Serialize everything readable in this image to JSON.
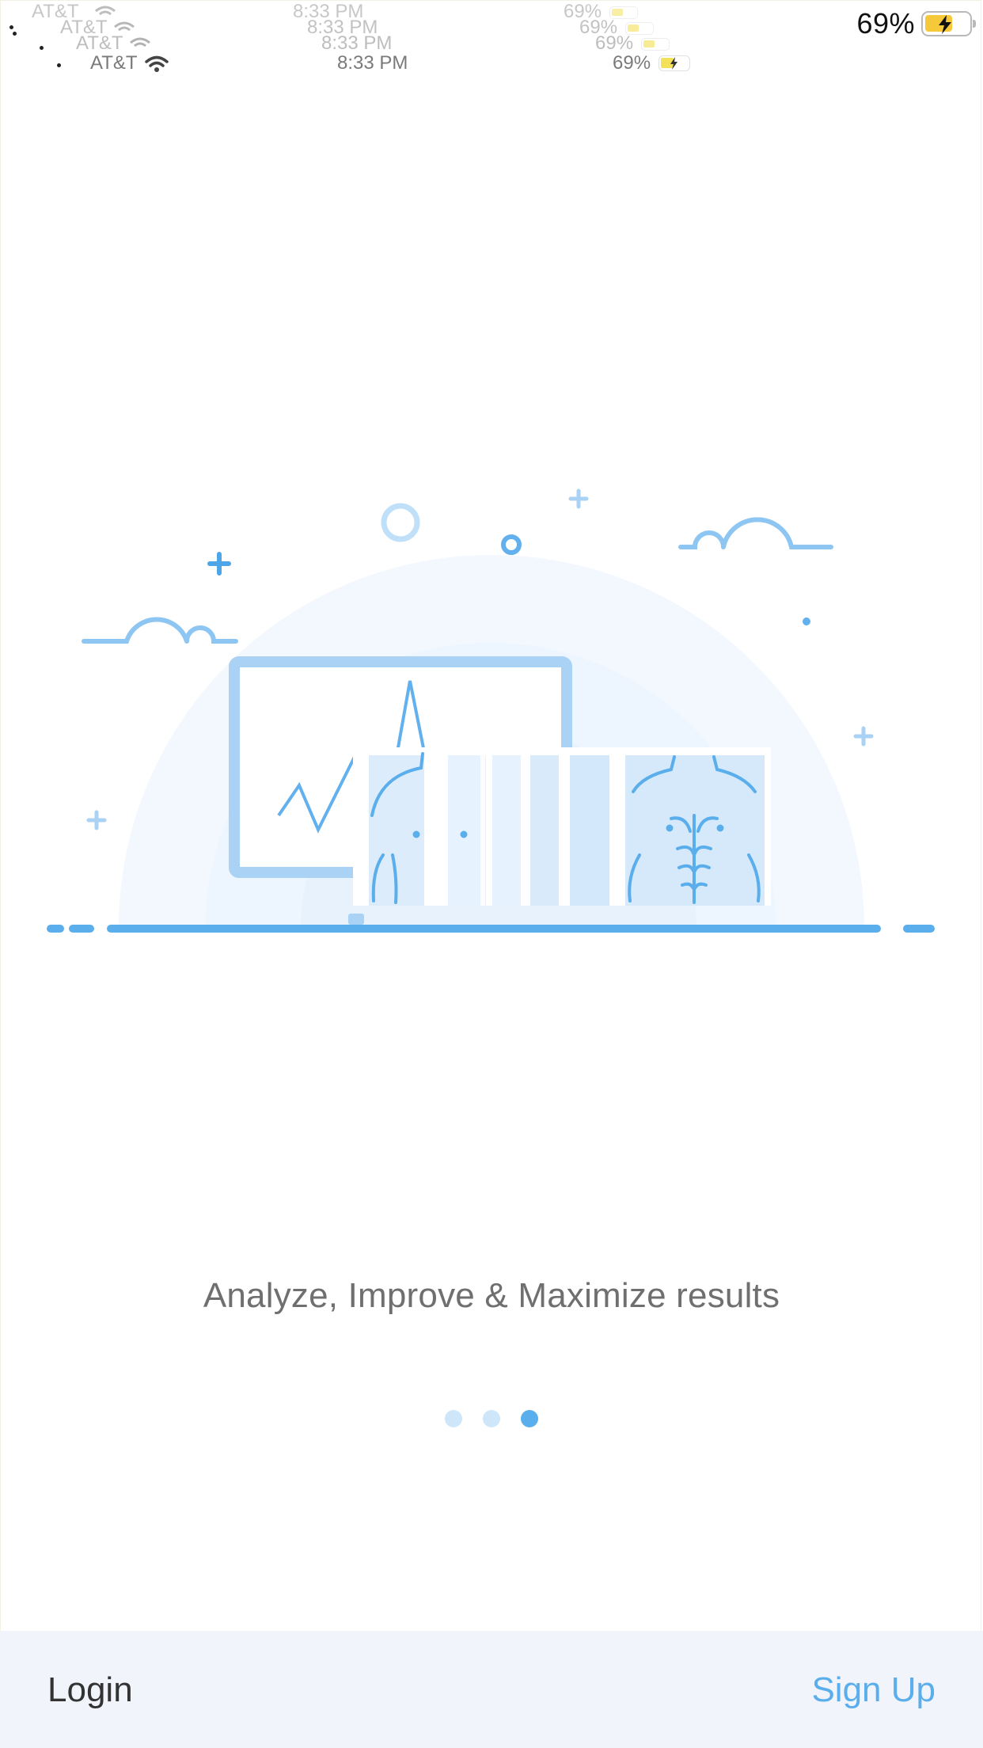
{
  "status_bar": {
    "carrier": "AT&T",
    "time": "8:33 PM",
    "battery_percent": "69%",
    "battery_color": "#f5c93a"
  },
  "onboarding": {
    "tagline": "Analyze, Improve & Maximize results",
    "pager": {
      "total": 3,
      "active_index": 2
    }
  },
  "bottom_bar": {
    "login_label": "Login",
    "signup_label": "Sign Up"
  },
  "colors": {
    "accent": "#5aaeeb",
    "line_blue": "#62b1ee",
    "light_blue": "#a9d2f4",
    "bottom_bar_bg": "#f2f4fb",
    "text_gray": "#6f6f6f"
  },
  "icons": [
    "wifi-icon",
    "battery-icon",
    "charging-bolt-icon",
    "body-scan-illustration"
  ]
}
